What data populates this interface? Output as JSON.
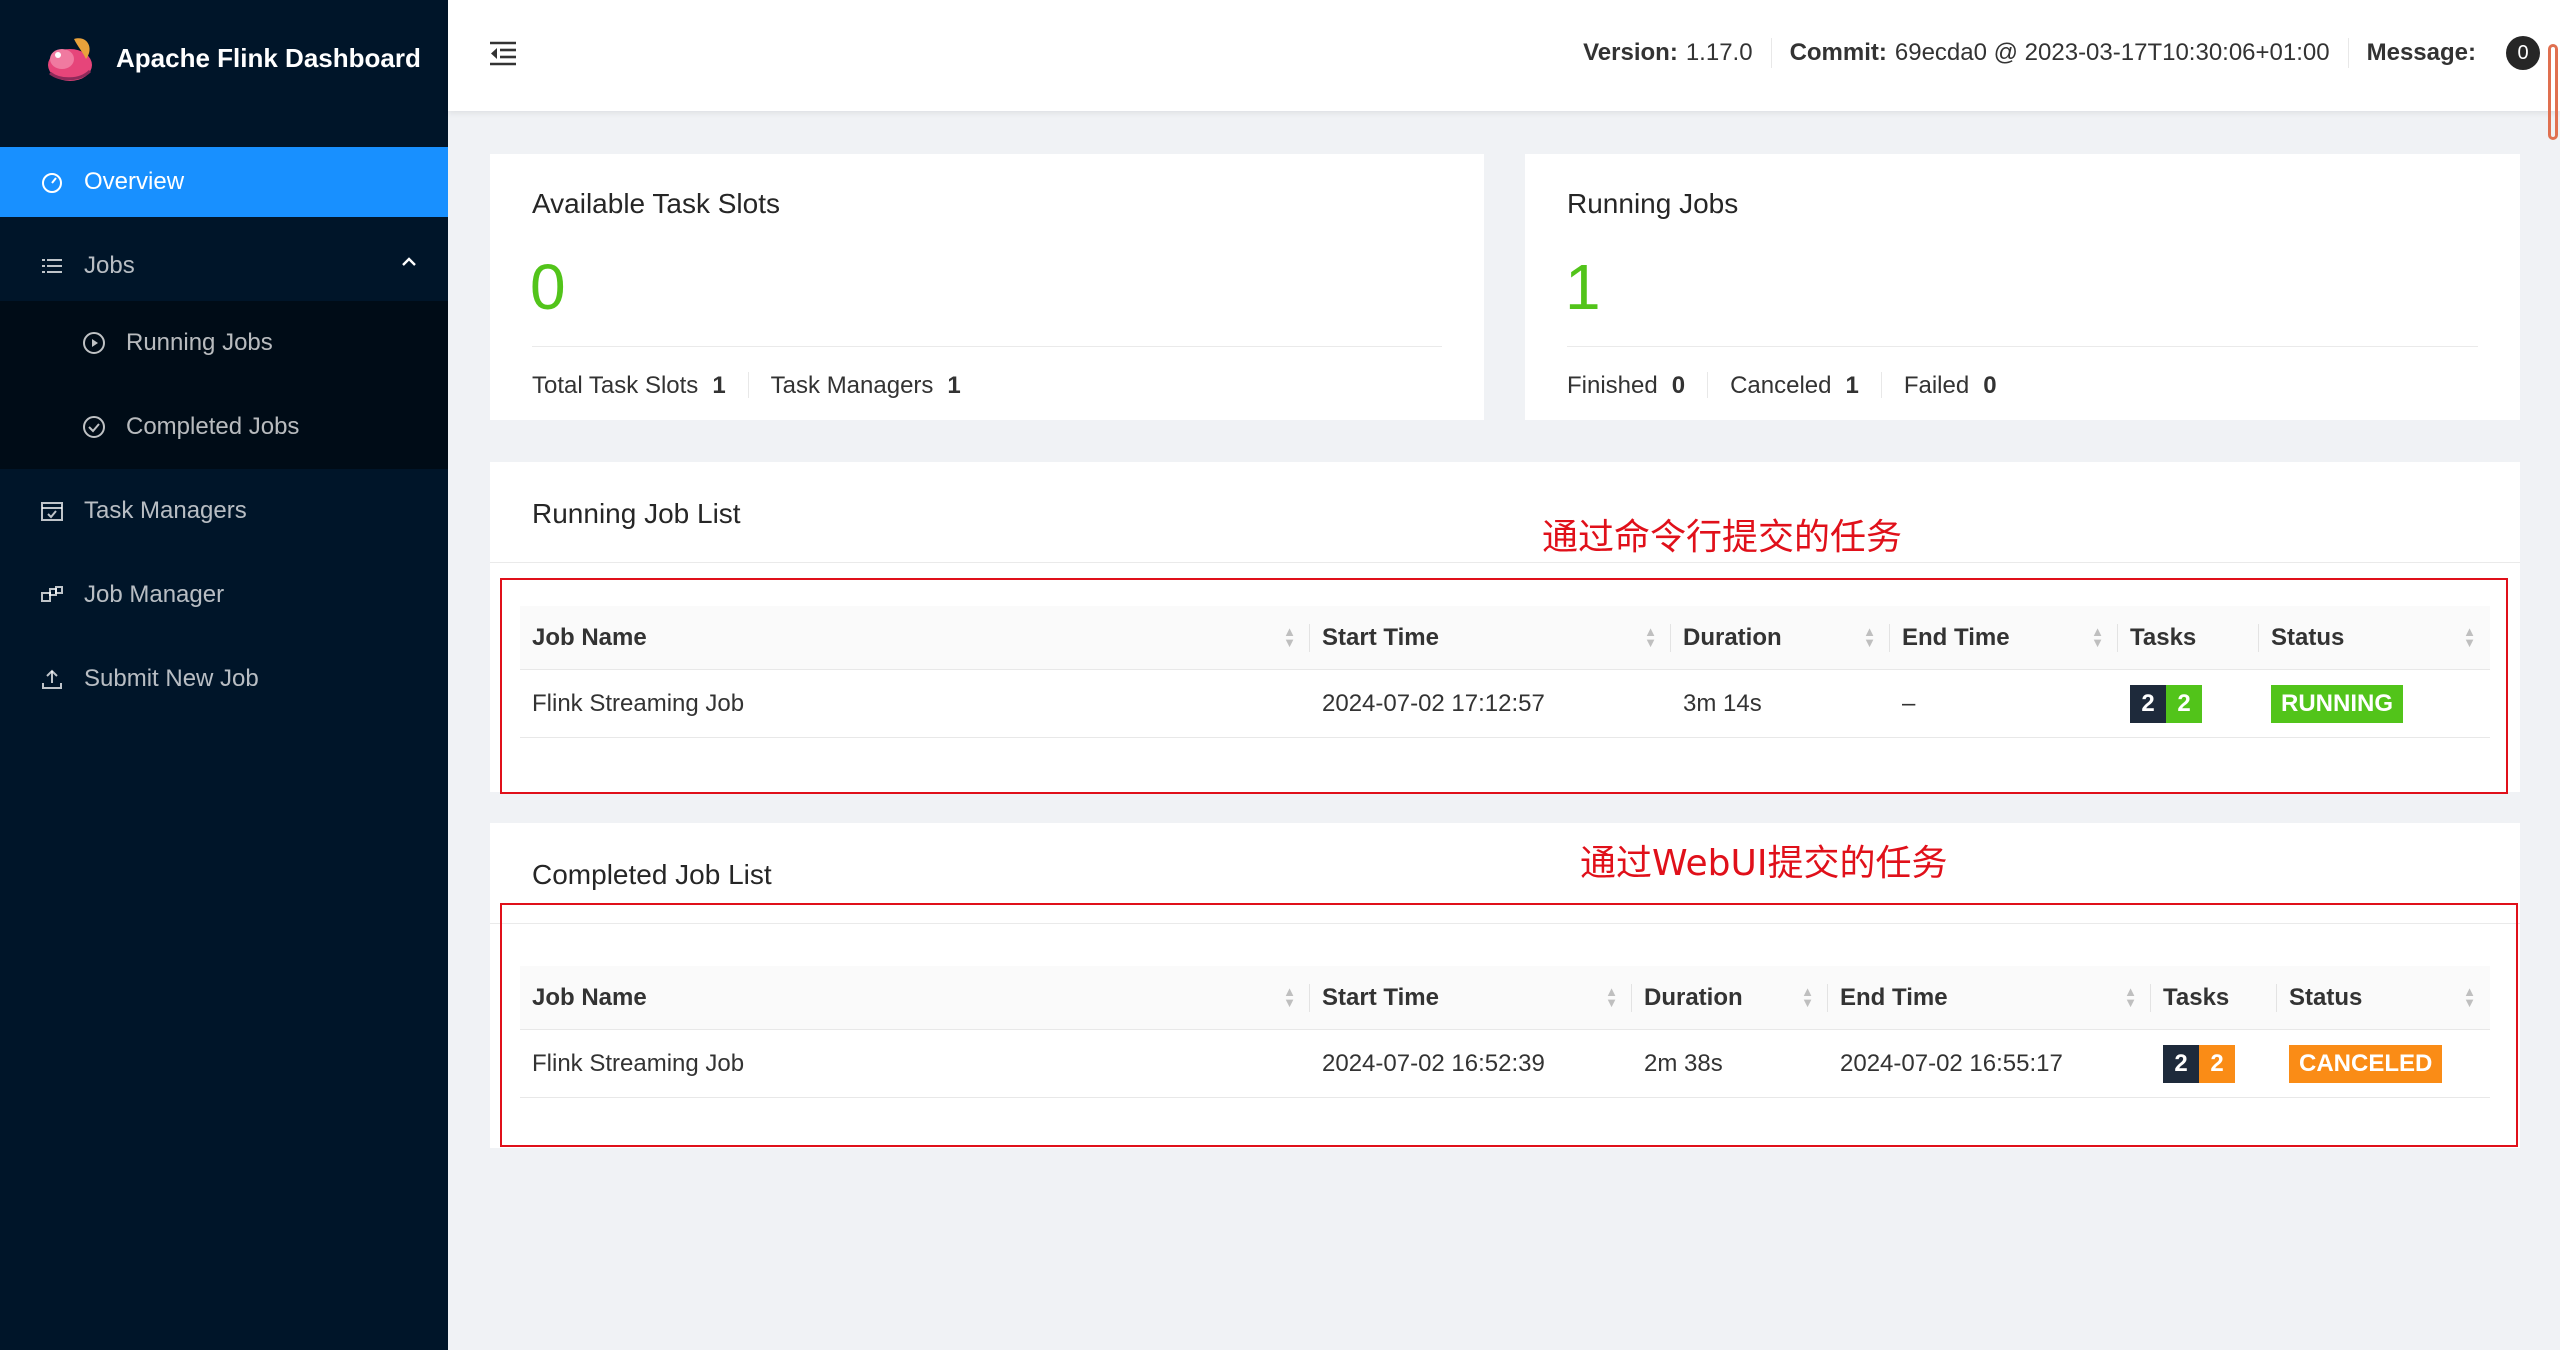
{
  "brand": {
    "title": "Apache Flink Dashboard",
    "logo_icon": "squirrel-logo-icon"
  },
  "sidebar": {
    "items": [
      {
        "label": "Overview",
        "icon": "dashboard-icon",
        "active": true
      },
      {
        "label": "Jobs",
        "icon": "list-icon",
        "expanded": true
      },
      {
        "label": "Running Jobs",
        "icon": "play-circle-icon"
      },
      {
        "label": "Completed Jobs",
        "icon": "check-circle-icon"
      },
      {
        "label": "Task Managers",
        "icon": "schedule-icon"
      },
      {
        "label": "Job Manager",
        "icon": "build-icon"
      },
      {
        "label": "Submit New Job",
        "icon": "upload-icon"
      }
    ]
  },
  "header": {
    "version_label": "Version:",
    "version_value": "1.17.0",
    "commit_label": "Commit:",
    "commit_value": "69ecda0 @ 2023-03-17T10:30:06+01:00",
    "message_label": "Message:",
    "message_count": "0"
  },
  "slots_card": {
    "title": "Available Task Slots",
    "value": "0",
    "total_label": "Total Task Slots",
    "total_value": "1",
    "tm_label": "Task Managers",
    "tm_value": "1"
  },
  "jobs_card": {
    "title": "Running Jobs",
    "value": "1",
    "finished_label": "Finished",
    "finished_value": "0",
    "canceled_label": "Canceled",
    "canceled_value": "1",
    "failed_label": "Failed",
    "failed_value": "0"
  },
  "running_list": {
    "title": "Running Job List",
    "columns": [
      "Job Name",
      "Start Time",
      "Duration",
      "End Time",
      "Tasks",
      "Status"
    ],
    "rows": [
      {
        "name": "Flink Streaming Job",
        "start": "2024-07-02 17:12:57",
        "duration": "3m 14s",
        "end": "–",
        "tasks_total": "2",
        "tasks_state": "2",
        "status": "RUNNING"
      }
    ]
  },
  "completed_list": {
    "title": "Completed Job List",
    "columns": [
      "Job Name",
      "Start Time",
      "Duration",
      "End Time",
      "Tasks",
      "Status"
    ],
    "rows": [
      {
        "name": "Flink Streaming Job",
        "start": "2024-07-02 16:52:39",
        "duration": "2m 38s",
        "end": "2024-07-02 16:55:17",
        "tasks_total": "2",
        "tasks_state": "2",
        "status": "CANCELED"
      }
    ]
  },
  "annotations": {
    "running": "通过命令行提交的任务",
    "completed": "通过WebUI提交的任务",
    "color": "#e0101a"
  },
  "colors": {
    "sidebar_bg": "#001529",
    "active": "#1890ff",
    "running": "#52c41a",
    "canceled": "#fa8c16"
  }
}
